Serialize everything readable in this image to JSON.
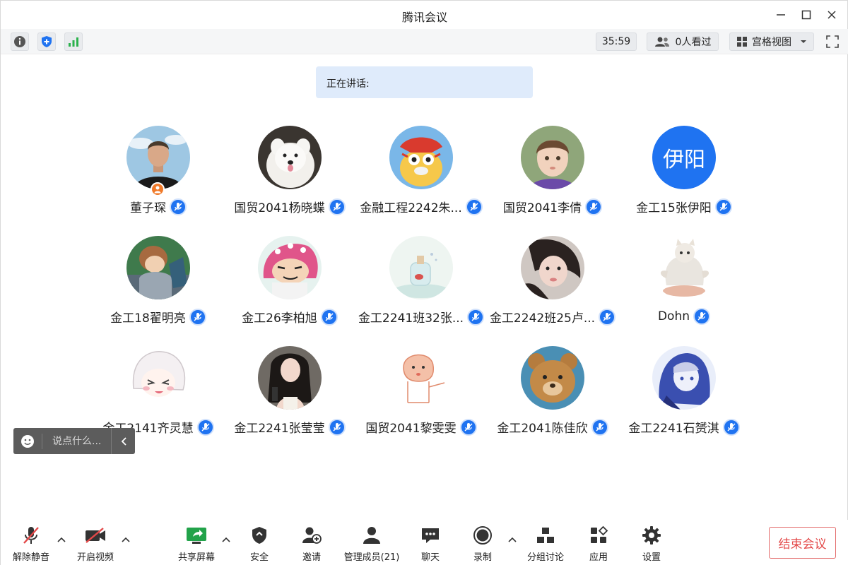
{
  "window": {
    "title": "腾讯会议"
  },
  "toolbar": {
    "timer": "35:59",
    "viewers": "0人看过",
    "view_mode": "宫格视图"
  },
  "speaking": {
    "label": "正在讲话:"
  },
  "participants": [
    {
      "name": "董子琛",
      "avatar": "photo-man",
      "host": true
    },
    {
      "name": "国贸2041杨晓蝶",
      "avatar": "photo-dog"
    },
    {
      "name": "金融工程2242朱...",
      "avatar": "cartoon-bird"
    },
    {
      "name": "国贸2041李倩",
      "avatar": "photo-child"
    },
    {
      "name": "金工15张伊阳",
      "avatar": "text",
      "avatar_text": "伊阳"
    },
    {
      "name": "金工18翟明亮",
      "avatar": "cartoon-sleep"
    },
    {
      "name": "金工26李柏旭",
      "avatar": "cartoon-shinchan"
    },
    {
      "name": "金工2241班32张...",
      "avatar": "photo-bottle"
    },
    {
      "name": "金工2242班25卢...",
      "avatar": "photo-girl"
    },
    {
      "name": "Dohn",
      "avatar": "photo-cat"
    },
    {
      "name": "金工2141齐灵慧",
      "avatar": "cartoon-anime-white"
    },
    {
      "name": "金工2241张莹莹",
      "avatar": "photo-woman"
    },
    {
      "name": "国贸2041黎雯雯",
      "avatar": "cartoon-doodle"
    },
    {
      "name": "金工2041陈佳欣",
      "avatar": "photo-bear"
    },
    {
      "name": "金工2241石赟淇",
      "avatar": "cartoon-anime-blue"
    }
  ],
  "chat": {
    "placeholder": "说点什么..."
  },
  "bottom": {
    "unmute": "解除静音",
    "video": "开启视频",
    "share": "共享屏幕",
    "security": "安全",
    "invite": "邀请",
    "members": "管理成员(21)",
    "chat": "聊天",
    "record": "录制",
    "breakout": "分组讨论",
    "apps": "应用",
    "settings": "设置",
    "end": "结束会议"
  },
  "colors": {
    "accent": "#1f73f1",
    "end_red": "#e34848",
    "signal_green": "#2bb24c"
  }
}
